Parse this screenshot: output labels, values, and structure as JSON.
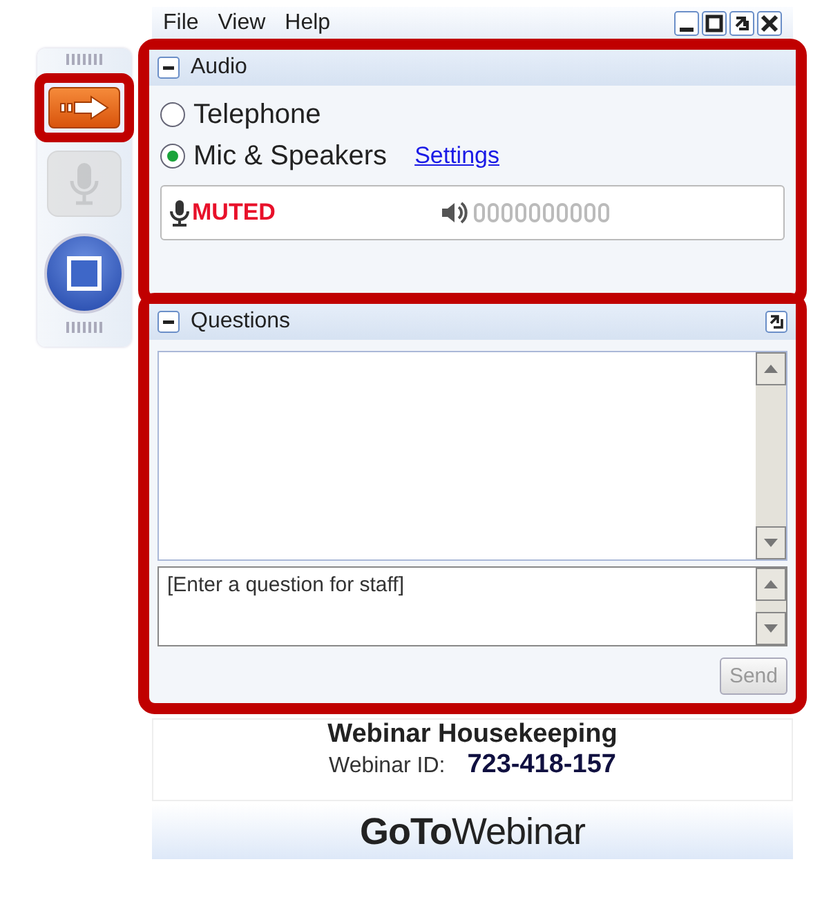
{
  "toolbar": {
    "buttons": [
      {
        "kind": "arrow",
        "highlighted": true,
        "disabled": false
      },
      {
        "kind": "mic",
        "highlighted": false,
        "disabled": true
      },
      {
        "kind": "stop",
        "highlighted": false,
        "disabled": false
      }
    ]
  },
  "menu": [
    "File",
    "View",
    "Help"
  ],
  "audio": {
    "title": "Audio",
    "highlighted": true,
    "options": [
      {
        "label": "Telephone",
        "selected": false
      },
      {
        "label": "Mic & Speakers",
        "selected": true
      }
    ],
    "settings_link": "Settings",
    "mic_status": "MUTED"
  },
  "questions": {
    "title": "Questions",
    "highlighted": true,
    "placeholder": "[Enter a question for staff]",
    "send": {
      "label": "Send",
      "disabled": true
    }
  },
  "footer": {
    "title": "Webinar Housekeeping",
    "id_label": "Webinar ID:",
    "id_value": "723-418-157",
    "logo": "**GoTo**Webinar"
  }
}
